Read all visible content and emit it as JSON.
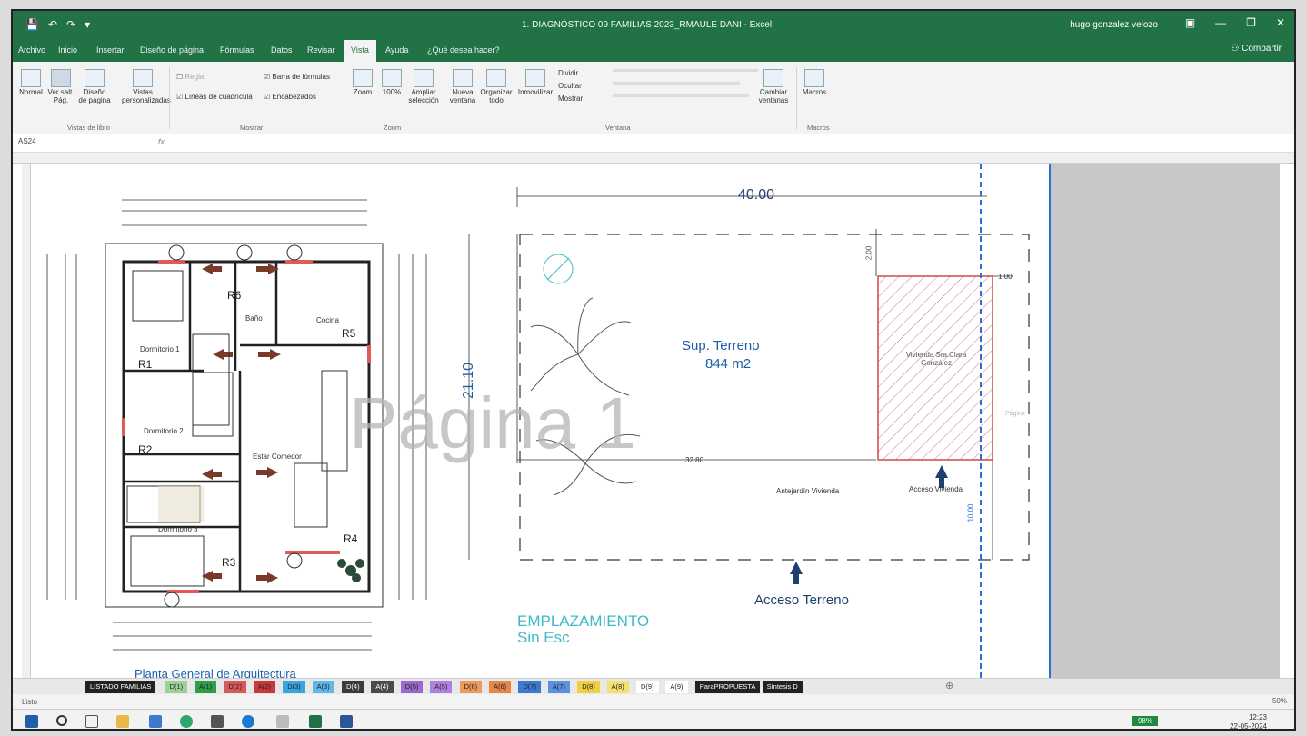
{
  "window": {
    "title": "1. DIAGNÓSTICO 09 FAMILIAS 2023_RMAULE DANI  -  Excel",
    "user": "hugo gonzalez velozo",
    "share": "Compartir"
  },
  "tabs": [
    "Archivo",
    "Inicio",
    "Insertar",
    "Diseño de página",
    "Fórmulas",
    "Datos",
    "Revisar",
    "Vista",
    "Ayuda",
    "¿Qué desea hacer?"
  ],
  "ribbon": {
    "views": {
      "normal": "Normal",
      "pagebreak": "Ver salt. Pág.",
      "pagelayout": "Diseño de página",
      "custom": "Vistas personalizadas",
      "label": "Vistas de libro"
    },
    "show": {
      "regla": "Regla",
      "barra": "Barra de fórmulas",
      "lineas": "Líneas de cuadrícula",
      "encabezados": "Encabezados",
      "label": "Mostrar"
    },
    "zoom": {
      "zoom": "Zoom",
      "cien": "100%",
      "ampliar": "Ampliar selección",
      "label": "Zoom"
    },
    "window": {
      "nueva": "Nueva ventana",
      "organizar": "Organizar todo",
      "inmovilizar": "Inmovilizar",
      "dividir": "Dividir",
      "ocultar": "Ocultar",
      "mostrar": "Mostrar",
      "label": "Ventana",
      "cambiar": "Cambiar ventanas"
    },
    "macros": {
      "macros": "Macros",
      "label": "Macros"
    }
  },
  "formula": {
    "namebox": "AS24",
    "fx": "fx"
  },
  "drawing": {
    "watermark": "Página 1",
    "dim_top": "40.00",
    "dim_side": "21.10",
    "dim_inner": "32.80",
    "dim_2": "2.00",
    "dim_1": "1.00",
    "dim_10": "10.00",
    "sup_terreno": "Sup. Terreno",
    "sup_value": "844 m2",
    "vivienda": "Vivienda Sra.Clara González",
    "acceso_vivienda": "Acceso Vivienda",
    "antejardin": "Antejardín  Vivienda",
    "acceso_terreno": "Acceso Terreno",
    "emplazamiento": "EMPLAZAMIENTO",
    "sin_esc": "Sin Esc",
    "planta": "Planta General de Arquitectura",
    "rooms": {
      "dormitorio1": "Dormitorio 1",
      "dormitorio2": "Dormitorio 2",
      "dormitorio3": "Dormitorio 3",
      "bano": "Baño",
      "cocina": "Cocina",
      "estar": "Estar Comedor"
    },
    "refs": [
      "R1",
      "R2",
      "R3",
      "R4",
      "R5",
      "R6"
    ],
    "page_label": "Página"
  },
  "sheets": [
    {
      "name": "LISTADO FAMILIAS",
      "bg": "#222222",
      "fg": "#ffffff"
    },
    {
      "name": "D(1)",
      "bg": "#9ad29a",
      "fg": "#222222"
    },
    {
      "name": "A(1)",
      "bg": "#2e9e4a",
      "fg": "#222222"
    },
    {
      "name": "D(2)",
      "bg": "#d65a5a",
      "fg": "#222222"
    },
    {
      "name": "A(2)",
      "bg": "#c83a3a",
      "fg": "#222222"
    },
    {
      "name": "D(3)",
      "bg": "#3aa6e0",
      "fg": "#222222"
    },
    {
      "name": "A(3)",
      "bg": "#5fb8e8",
      "fg": "#222222"
    },
    {
      "name": "D(4)",
      "bg": "#3a3a3a",
      "fg": "#ffffff"
    },
    {
      "name": "A(4)",
      "bg": "#4a4a4a",
      "fg": "#ffffff"
    },
    {
      "name": "D(5)",
      "bg": "#9a6ad0",
      "fg": "#222222"
    },
    {
      "name": "A(5)",
      "bg": "#b080e0",
      "fg": "#222222"
    },
    {
      "name": "D(6)",
      "bg": "#f09a5a",
      "fg": "#222222"
    },
    {
      "name": "A(6)",
      "bg": "#e8864a",
      "fg": "#222222"
    },
    {
      "name": "D(7)",
      "bg": "#3a7ad0",
      "fg": "#222222"
    },
    {
      "name": "A(7)",
      "bg": "#5a92e0",
      "fg": "#222222"
    },
    {
      "name": "D(8)",
      "bg": "#f0d040",
      "fg": "#222222"
    },
    {
      "name": "A(8)",
      "bg": "#f5e070",
      "fg": "#222222"
    },
    {
      "name": "D(9)",
      "bg": "#ffffff",
      "fg": "#222222"
    },
    {
      "name": "A(9)",
      "bg": "#ffffff",
      "fg": "#222222"
    },
    {
      "name": "ParaPROPUESTA",
      "bg": "#222222",
      "fg": "#ffffff"
    },
    {
      "name": "Síntesis D",
      "bg": "#222222",
      "fg": "#ffffff"
    }
  ],
  "status": {
    "ready": "Listo",
    "zoom": "50%"
  },
  "taskbar": {
    "battery": "98%",
    "time": "12:23",
    "date": "22-05-2024"
  }
}
